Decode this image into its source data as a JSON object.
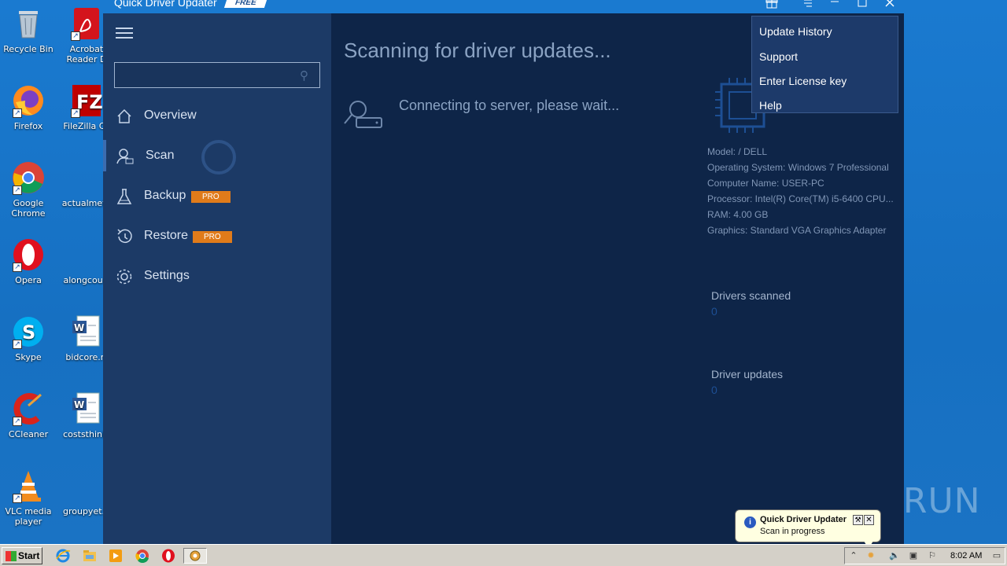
{
  "desktop": {
    "icons_col1": [
      {
        "label": "Recycle Bin",
        "icon": "recycle-bin-icon"
      },
      {
        "label": "Firefox",
        "icon": "firefox-icon"
      },
      {
        "label": "Google Chrome",
        "icon": "chrome-icon"
      },
      {
        "label": "Opera",
        "icon": "opera-icon"
      },
      {
        "label": "Skype",
        "icon": "skype-icon"
      },
      {
        "label": "CCleaner",
        "icon": "ccleaner-icon"
      },
      {
        "label": "VLC media player",
        "icon": "vlc-icon"
      }
    ],
    "icons_col2": [
      {
        "label": "Acrobat Reader D",
        "icon": "acrobat-icon"
      },
      {
        "label": "FileZilla Cli",
        "icon": "filezilla-icon"
      },
      {
        "label": "actualmeta",
        "icon": "blank-file-icon"
      },
      {
        "label": "alongcourt",
        "icon": "blank-file-icon"
      },
      {
        "label": "bidcore.rt",
        "icon": "word-doc-icon"
      },
      {
        "label": "coststhink.",
        "icon": "word-doc-icon"
      },
      {
        "label": "groupyet.p",
        "icon": "blank-file-icon"
      }
    ]
  },
  "app": {
    "title": "Quick Driver Updater",
    "badge": "FREE",
    "titlebar_buttons": [
      "gift-icon",
      "menu-icon",
      "minimize-icon",
      "maximize-icon",
      "close-icon"
    ],
    "search": {
      "placeholder": "",
      "value": ""
    },
    "nav": [
      {
        "label": "Overview",
        "icon": "home-icon",
        "pro": ""
      },
      {
        "label": "Scan",
        "icon": "scan-user-icon",
        "pro": ""
      },
      {
        "label": "Backup",
        "icon": "flask-icon",
        "pro": "PRO"
      },
      {
        "label": "Restore",
        "icon": "history-icon",
        "pro": "PRO"
      },
      {
        "label": "Settings",
        "icon": "gear-icon",
        "pro": ""
      }
    ],
    "active_nav": "Scan",
    "main": {
      "title": "Scanning for driver updates...",
      "status": "Connecting to server, please wait..."
    },
    "system_info": {
      "model": "Model:  / DELL",
      "os": "Operating System: Windows 7 Professional",
      "computer": "Computer Name: USER-PC",
      "processor": " Processor: Intel(R) Core(TM) i5-6400 CPU...",
      "ram": "RAM: 4.00 GB",
      "graphics": "Graphics: Standard VGA Graphics Adapter"
    },
    "stats": {
      "drivers_scanned_label": "Drivers scanned",
      "drivers_scanned_value": "0",
      "driver_updates_label": "Driver updates",
      "driver_updates_value": "0"
    },
    "menu": [
      "Update History",
      "Support",
      "Enter License key",
      "Help"
    ]
  },
  "balloon": {
    "title": "Quick Driver Updater",
    "text": "Scan in progress"
  },
  "watermark": "ANY RUN",
  "taskbar": {
    "start_label": "Start",
    "apps": [
      "ie-icon",
      "explorer-icon",
      "media-player-icon",
      "chrome-icon",
      "opera-icon",
      "quick-driver-updater-icon"
    ],
    "clock": "8:02 AM"
  },
  "colors": {
    "accent": "#1a7ad0",
    "sidebar": "#1c3a66",
    "main_bg": "#0e2548",
    "pro_badge": "#e07b1a"
  }
}
